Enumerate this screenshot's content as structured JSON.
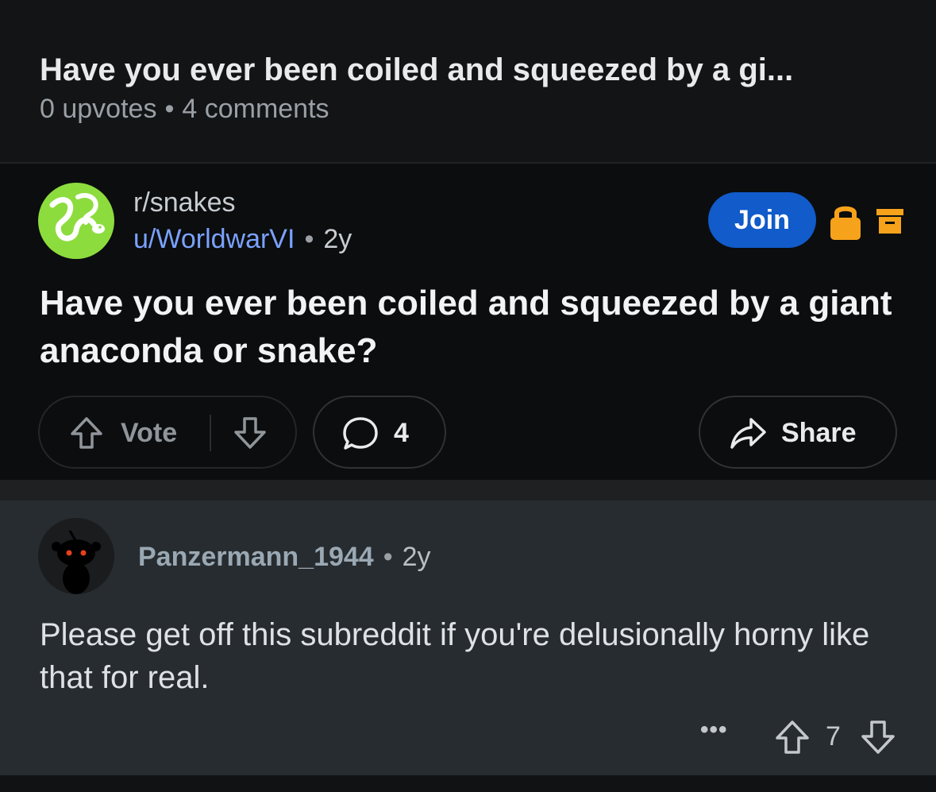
{
  "header": {
    "title": "Have you ever been coiled and squeezed by a gi...",
    "upvotes": "0 upvotes",
    "separator": "•",
    "comments": "4 comments"
  },
  "post": {
    "subreddit": "r/snakes",
    "author": "u/WorldwarVI",
    "separator": "•",
    "age": "2y",
    "join_label": "Join",
    "title": "Have you ever been coiled and squeezed by a giant anaconda or snake?",
    "vote_label": "Vote",
    "comment_count": "4",
    "share_label": "Share",
    "icons": {
      "subreddit_avatar": "snake-avatar-icon",
      "lock": "lock-icon",
      "archive": "archive-icon",
      "upvote": "upvote-arrow-icon",
      "downvote": "downvote-arrow-icon",
      "comment": "comment-bubble-icon",
      "share": "share-arrow-icon"
    },
    "colors": {
      "join": "#115bca",
      "lock": "#f7a21b",
      "avatar_bg": "#8ddc3e",
      "author": "#7aa2ff"
    }
  },
  "comment": {
    "author": "Panzermann_1944",
    "separator": "•",
    "age": "2y",
    "body": "Please get off this subreddit if you're delusionally horny like that for real.",
    "more_label": "•••",
    "score": "7"
  }
}
